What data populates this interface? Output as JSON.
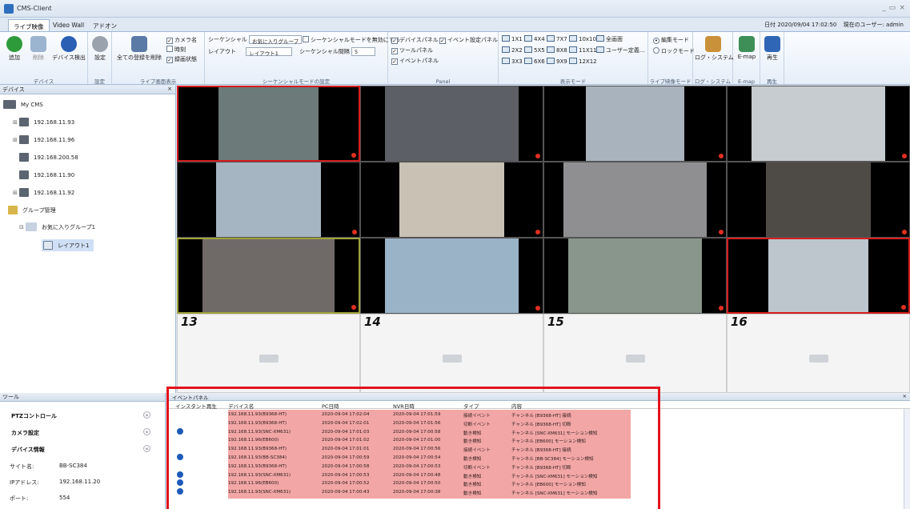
{
  "app": {
    "title": "CMS-Client",
    "window_controls": [
      "_",
      "▭",
      "×"
    ]
  },
  "tabs": [
    "ライブ映像",
    "Video Wall",
    "アドオン"
  ],
  "status": {
    "date_label": "日付",
    "date": "2020/09/04 17:02:50",
    "user_label": "現在のユーザー: admin"
  },
  "ribbon": {
    "device": {
      "add": "追加",
      "delete": "削除",
      "discover": "デバイス検出",
      "label": "デバイス"
    },
    "settings": {
      "button": "設定",
      "label": "設定"
    },
    "live": {
      "clear": "全ての登録を削除",
      "camera_name": "カメラ名",
      "time": "時刻",
      "rec_status": "録画状態",
      "label": "ライブ画面表示"
    },
    "sequence": {
      "seq_label": "シーケンシャル",
      "seq_value": "お気に入りグループ",
      "disable": "シーケンシャルモードを無効にする",
      "layout_label": "レイアウト",
      "layout_value": "レイアウト1",
      "interval_label": "シーケンシャル間隔",
      "interval_value": "5",
      "label": "シーケンシャルモードの設定"
    },
    "panel": {
      "device_panel": "デバイスパネル",
      "event_panel_settings": "イベント設定パネル",
      "tool_panel": "ツールパネル",
      "event_panel": "イベントパネル",
      "label": "Panel"
    },
    "display": {
      "layouts": [
        "1X1",
        "4X4",
        "7X7",
        "10x10",
        "全画面",
        "2X2",
        "5X5",
        "8X8",
        "11X11",
        "ユーザー定義...",
        "3X3",
        "6X6",
        "9X9",
        "12X12"
      ],
      "label": "表示モード"
    },
    "mode": {
      "edit": "編集モード",
      "lock": "ロックモード",
      "label": "ライブ映像モード"
    },
    "log": {
      "button": "ログ・システム",
      "label": "ログ・システム"
    },
    "emap": {
      "button": "E-map",
      "label": "E-map"
    },
    "playback": {
      "button": "再生",
      "label": "再生"
    }
  },
  "device_panel": {
    "title": "デバイス",
    "root": "My CMS",
    "devices": [
      "192.168.11.93",
      "192.168.11.96",
      "192.168.200.58",
      "192.168.11.90",
      "192.168.11.92"
    ],
    "group": "グループ管理",
    "favorite": "お気に入りグループ1",
    "layout": "レイアウト1"
  },
  "tool_panel": {
    "title": "ツール",
    "sections": [
      "PTZコントロール",
      "カメラ設定",
      "デバイス情報"
    ],
    "info": [
      {
        "k": "サイト名:",
        "v": "BB-SC384"
      },
      {
        "k": "IPアドレス:",
        "v": "192.168.11.20"
      },
      {
        "k": "ポート:",
        "v": "554"
      }
    ]
  },
  "video": {
    "empty_labels": [
      "13",
      "14",
      "15",
      "16"
    ]
  },
  "event_panel": {
    "title": "イベントパネル",
    "columns": [
      "インスタント再生",
      "デバイス名",
      "PC日時",
      "NVR日時",
      "タイプ",
      "内容"
    ],
    "rows": [
      {
        "dev": "192.168.11.93(B9368-HT)",
        "pc": "2020-09-04 17:02:04",
        "nvr": "2020-09-04 17:01:59",
        "type": "接続イベント",
        "content": "チャンネル [B9368-HT] 接続",
        "icon": false
      },
      {
        "dev": "192.168.11.93(B9368-HT)",
        "pc": "2020-09-04 17:02:01",
        "nvr": "2020-09-04 17:01:56",
        "type": "切断イベント",
        "content": "チャンネル [B9368-HT] 切断",
        "icon": false
      },
      {
        "dev": "192.168.11.93(SNC-XM631)",
        "pc": "2020-09-04 17:01:03",
        "nvr": "2020-09-04 17:00:58",
        "type": "動き検知",
        "content": "チャンネル [SNC-XM631] モーション検知",
        "icon": true
      },
      {
        "dev": "192.168.11.96(EB600)",
        "pc": "2020-09-04 17:01:02",
        "nvr": "2020-09-04 17:01:00",
        "type": "動き検知",
        "content": "チャンネル [EB600] モーション検知",
        "icon": false
      },
      {
        "dev": "192.168.11.93(B9368-HT)",
        "pc": "2020-09-04 17:01:01",
        "nvr": "2020-09-04 17:00:56",
        "type": "接続イベント",
        "content": "チャンネル [B9368-HT] 接続",
        "icon": false
      },
      {
        "dev": "192.168.11.93(BB-SC384)",
        "pc": "2020-09-04 17:00:59",
        "nvr": "2020-09-04 17:00:54",
        "type": "動き検知",
        "content": "チャンネル [BB-SC384] モーション検知",
        "icon": true
      },
      {
        "dev": "192.168.11.93(B9368-HT)",
        "pc": "2020-09-04 17:00:58",
        "nvr": "2020-09-04 17:00:53",
        "type": "切断イベント",
        "content": "チャンネル [B9368-HT] 切断",
        "icon": false
      },
      {
        "dev": "192.168.11.93(SNC-XM631)",
        "pc": "2020-09-04 17:00:53",
        "nvr": "2020-09-04 17:00:48",
        "type": "動き検知",
        "content": "チャンネル [SNC-XM631] モーション検知",
        "icon": true
      },
      {
        "dev": "192.168.11.96(EB600)",
        "pc": "2020-09-04 17:00:52",
        "nvr": "2020-09-04 17:00:50",
        "type": "動き検知",
        "content": "チャンネル [EB600] モーション検知",
        "icon": true
      },
      {
        "dev": "192.168.11.93(SNC-XM631)",
        "pc": "2020-09-04 17:00:43",
        "nvr": "2020-09-04 17:00:38",
        "type": "動き検知",
        "content": "チャンネル [SNC-XM631] モーション検知",
        "icon": true
      }
    ]
  },
  "colors": {
    "highlight_border": "#e2121b",
    "event_row_bg": "#f3a6a6",
    "ribbon_bg": "#e6eef8"
  }
}
